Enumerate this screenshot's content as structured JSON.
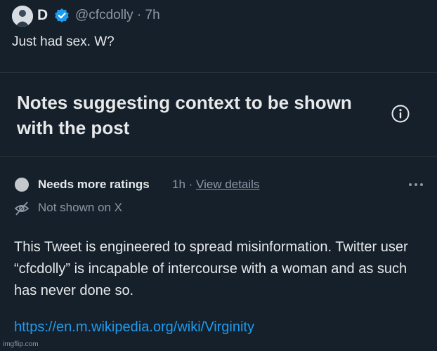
{
  "post": {
    "author_name": "D",
    "handle_time": "@cfcdolly · 7h",
    "text": "Just had sex. W?"
  },
  "notes_section": {
    "title": "Notes suggesting context to be shown with the post"
  },
  "note": {
    "status": "Needs more ratings",
    "time": "1h",
    "separator": " · ",
    "details_link": "View details",
    "visibility": "Not shown on X",
    "body": "This Tweet is engineered to spread misinformation. Twitter user “cfcdolly” is incapable of intercourse with a woman and as such has never done so.",
    "source_link": "https://en.m.wikipedia.org/wiki/Virginity"
  },
  "watermark": "imgflip.com",
  "colors": {
    "background": "#15202b",
    "accent": "#1d9bf0",
    "muted_text": "#8b98a5"
  },
  "icons": [
    "avatar",
    "verified-badge-icon",
    "info-icon",
    "status-dot",
    "more-options-icon",
    "eye-off-icon"
  ]
}
